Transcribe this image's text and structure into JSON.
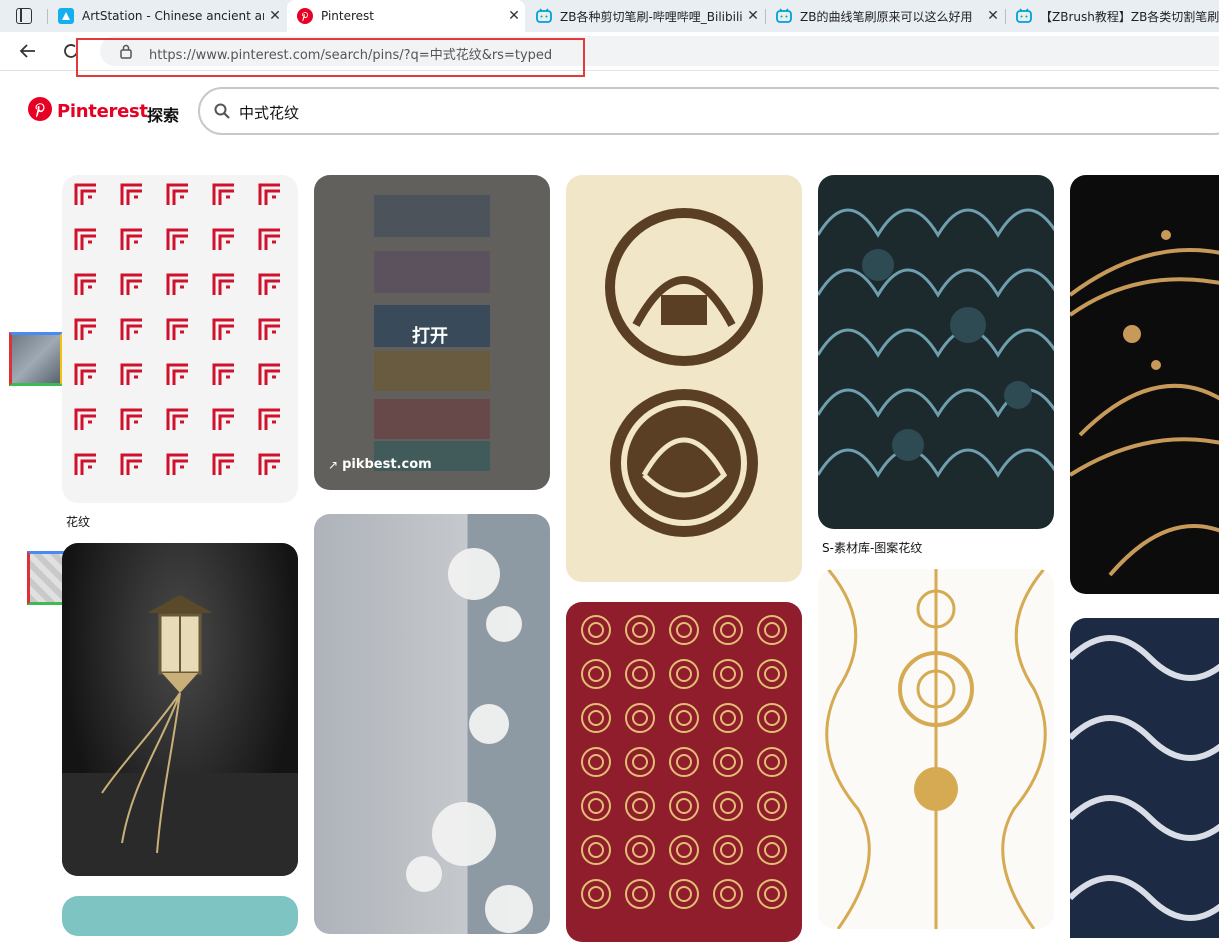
{
  "browser": {
    "tabs": [
      {
        "label": "ArtStation - Chinese ancient arch",
        "favicon": "artstation-icon"
      },
      {
        "label": "Pinterest",
        "favicon": "pinterest-icon",
        "active": true
      },
      {
        "label": "ZB各种剪切笔刷-哔哩哔哩_Bilibili",
        "favicon": "bilibili-icon"
      },
      {
        "label": "ZB的曲线笔刷原来可以这么好用",
        "favicon": "bilibili-icon"
      },
      {
        "label": "【ZBrush教程】ZB各类切割笔刷",
        "favicon": "bilibili-icon"
      }
    ],
    "close_glyph": "✕",
    "url": "https://www.pinterest.com/search/pins/?q=中式花纹&rs=typed",
    "accent_highlight": "#e23a3a"
  },
  "header": {
    "brand": "Pinterest",
    "explore": "探索",
    "search_value": "中式花纹",
    "brand_color": "#e60023"
  },
  "pins": {
    "pin1_caption": "花纹",
    "pin2_overlay": "打开",
    "pin2_source": "pikbest.com",
    "pin4_caption": "S-素材库-图案花纹"
  }
}
